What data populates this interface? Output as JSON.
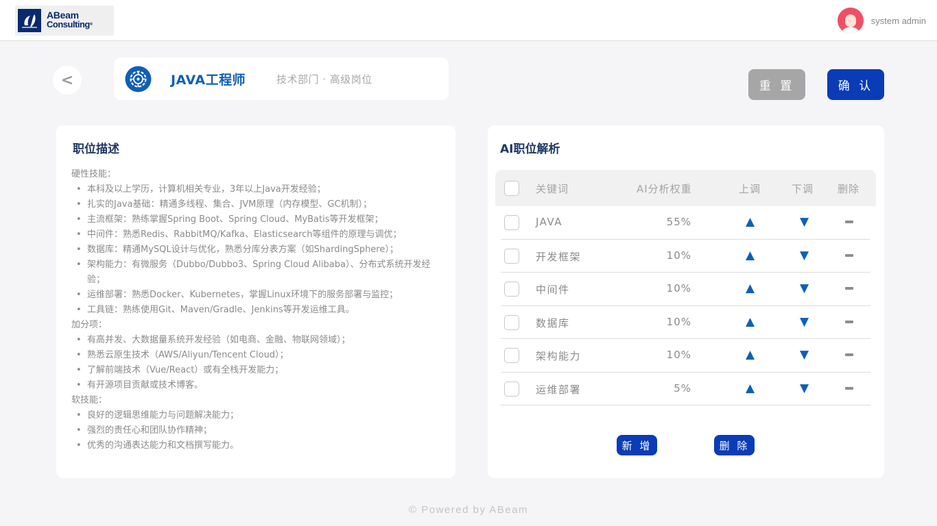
{
  "header": {
    "logo": {
      "line1": "ABeam",
      "line2": "Consulting",
      "mark": "®"
    },
    "user": {
      "name": "system admin",
      "avatar_icon": "user-avatar-icon"
    }
  },
  "job": {
    "back_label": "<",
    "title": "JAVA工程师",
    "subtitle": "技术部门 · 高级岗位",
    "icon": "gear-circuit-icon"
  },
  "actions": {
    "reset_label": "重 置",
    "confirm_label": "确 认"
  },
  "description": {
    "title": "职位描述",
    "sections": [
      {
        "heading": "硬性技能：",
        "items": [
          "本科及以上学历，计算机相关专业，3年以上Java开发经验；",
          "扎实的Java基础：精通多线程、集合、JVM原理（内存模型、GC机制）；",
          "主流框架：熟练掌握Spring Boot、Spring Cloud、MyBatis等开发框架；",
          "中间件：熟悉Redis、RabbitMQ/Kafka、Elasticsearch等组件的原理与调优；",
          "数据库：精通MySQL设计与优化，熟悉分库分表方案（如ShardingSphere）；",
          "架构能力：有微服务（Dubbo/Dubbo3、Spring Cloud Alibaba）、分布式系统开发经验；",
          "运维部署：熟悉Docker、Kubernetes，掌握Linux环境下的服务部署与监控；",
          "工具链：熟练使用Git、Maven/Gradle、Jenkins等开发运维工具。"
        ]
      },
      {
        "heading": "加分项：",
        "items": [
          "有高并发、大数据量系统开发经验（如电商、金融、物联网领域）；",
          "熟悉云原生技术（AWS/Aliyun/Tencent Cloud）；",
          "了解前端技术（Vue/React）或有全栈开发能力；",
          "有开源项目贡献或技术博客。"
        ]
      },
      {
        "heading": "软技能：",
        "items": [
          "良好的逻辑思维能力与问题解决能力；",
          "强烈的责任心和团队协作精神；",
          "优秀的沟通表达能力和文档撰写能力。"
        ]
      }
    ]
  },
  "analysis": {
    "title": "AI职位解析",
    "columns": {
      "keyword": "关键词",
      "weight": "AI分析权重",
      "up": "上调",
      "down": "下调",
      "delete": "删除"
    },
    "rows": [
      {
        "keyword": "JAVA",
        "weight": "55%"
      },
      {
        "keyword": "开发框架",
        "weight": "10%"
      },
      {
        "keyword": "中间件",
        "weight": "10%"
      },
      {
        "keyword": "数据库",
        "weight": "10%"
      },
      {
        "keyword": "架构能力",
        "weight": "10%"
      },
      {
        "keyword": "运维部署",
        "weight": "5%"
      }
    ],
    "up_symbol": "▲",
    "down_symbol": "▼",
    "add_label": "新 增",
    "delete_label": "删 除"
  },
  "footer": {
    "text": "© Powered by ABeam"
  },
  "colors": {
    "primary": "#0a3cb6",
    "accent": "#0f5fb5",
    "reset": "#a6a6a6",
    "avatar": "#f04f63"
  }
}
